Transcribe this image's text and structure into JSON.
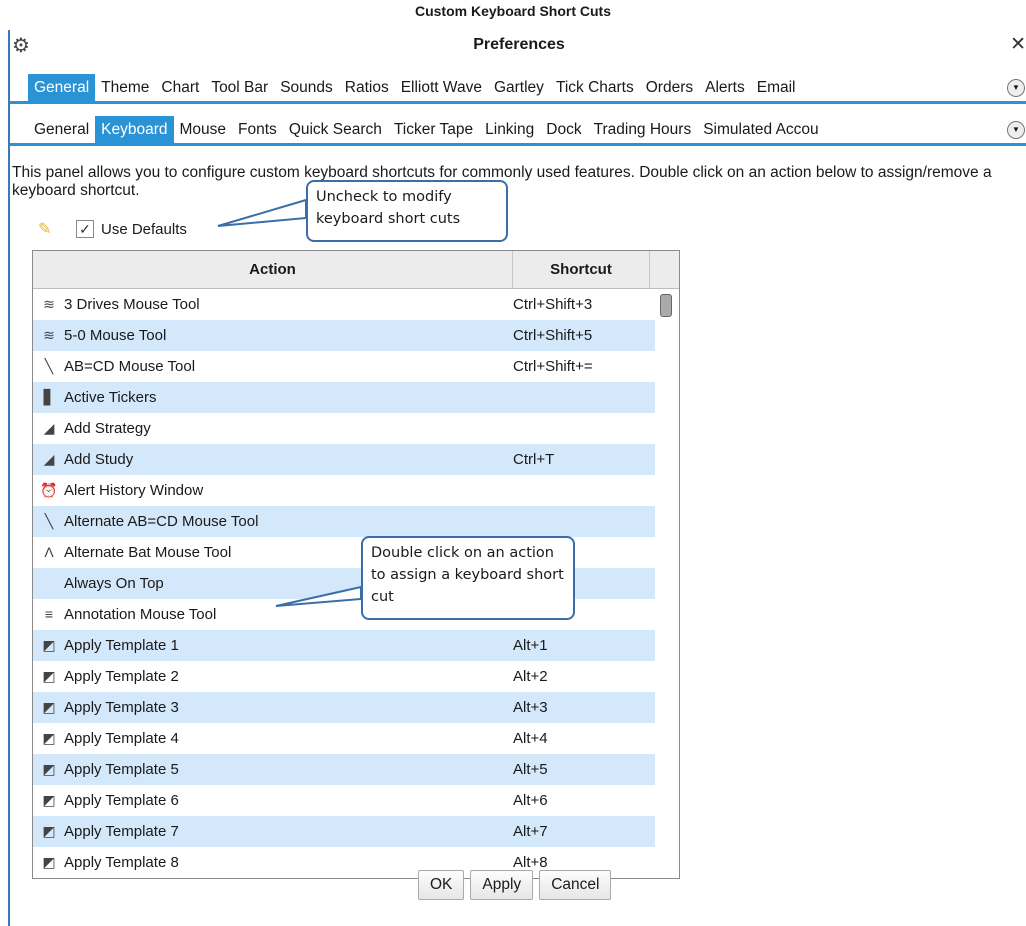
{
  "caption": "Custom Keyboard Short Cuts",
  "window": {
    "title": "Preferences",
    "gear_icon": "gear-icon",
    "close_glyph": "✕"
  },
  "tabs_top": [
    "General",
    "Theme",
    "Chart",
    "Tool Bar",
    "Sounds",
    "Ratios",
    "Elliott Wave",
    "Gartley",
    "Tick Charts",
    "Orders",
    "Alerts",
    "Email"
  ],
  "tabs_top_active": 0,
  "tabs_sub": [
    "General",
    "Keyboard",
    "Mouse",
    "Fonts",
    "Quick Search",
    "Ticker Tape",
    "Linking",
    "Dock",
    "Trading Hours",
    "Simulated Accou"
  ],
  "tabs_sub_active": 1,
  "description": "This panel allows you to configure custom keyboard shortcuts for commonly used features.  Double click on an action below to assign/remove a keyboard shortcut.",
  "use_defaults": {
    "label": "Use Defaults",
    "checked": true
  },
  "table": {
    "headers": {
      "action": "Action",
      "shortcut": "Shortcut"
    },
    "rows": [
      {
        "icon": "wave-icon",
        "action": "3 Drives Mouse Tool",
        "shortcut": "Ctrl+Shift+3"
      },
      {
        "icon": "wave-icon",
        "action": "5-0 Mouse Tool",
        "shortcut": "Ctrl+Shift+5"
      },
      {
        "icon": "zigzag-icon",
        "action": "AB=CD Mouse Tool",
        "shortcut": "Ctrl+Shift+="
      },
      {
        "icon": "ticker-icon",
        "action": "Active Tickers",
        "shortcut": ""
      },
      {
        "icon": "study-icon",
        "action": "Add Strategy",
        "shortcut": ""
      },
      {
        "icon": "study-icon",
        "action": "Add Study",
        "shortcut": "Ctrl+T"
      },
      {
        "icon": "alarm-icon",
        "action": "Alert History Window",
        "shortcut": ""
      },
      {
        "icon": "zigzag-icon",
        "action": "Alternate AB=CD Mouse Tool",
        "shortcut": ""
      },
      {
        "icon": "bat-icon",
        "action": "Alternate Bat Mouse Tool",
        "shortcut": ""
      },
      {
        "icon": "",
        "action": "Always On Top",
        "shortcut": ""
      },
      {
        "icon": "annotation-icon",
        "action": "Annotation Mouse Tool",
        "shortcut": ""
      },
      {
        "icon": "template-icon",
        "action": "Apply Template 1",
        "shortcut": "Alt+1"
      },
      {
        "icon": "template-icon",
        "action": "Apply Template 2",
        "shortcut": "Alt+2"
      },
      {
        "icon": "template-icon",
        "action": "Apply Template 3",
        "shortcut": "Alt+3"
      },
      {
        "icon": "template-icon",
        "action": "Apply Template 4",
        "shortcut": "Alt+4"
      },
      {
        "icon": "template-icon",
        "action": "Apply Template 5",
        "shortcut": "Alt+5"
      },
      {
        "icon": "template-icon",
        "action": "Apply Template 6",
        "shortcut": "Alt+6"
      },
      {
        "icon": "template-icon",
        "action": "Apply Template 7",
        "shortcut": "Alt+7"
      },
      {
        "icon": "template-icon",
        "action": "Apply Template 8",
        "shortcut": "Alt+8"
      }
    ]
  },
  "buttons": {
    "ok": "OK",
    "apply": "Apply",
    "cancel": "Cancel"
  },
  "callouts": {
    "defaults": "Uncheck to modify keyboard short cuts",
    "action": "Double click on an action to assign a keyboard short cut"
  },
  "colors": {
    "accent": "#2a93d5",
    "row_alt": "#d4e8fb",
    "callout_border": "#3a6ea8"
  }
}
